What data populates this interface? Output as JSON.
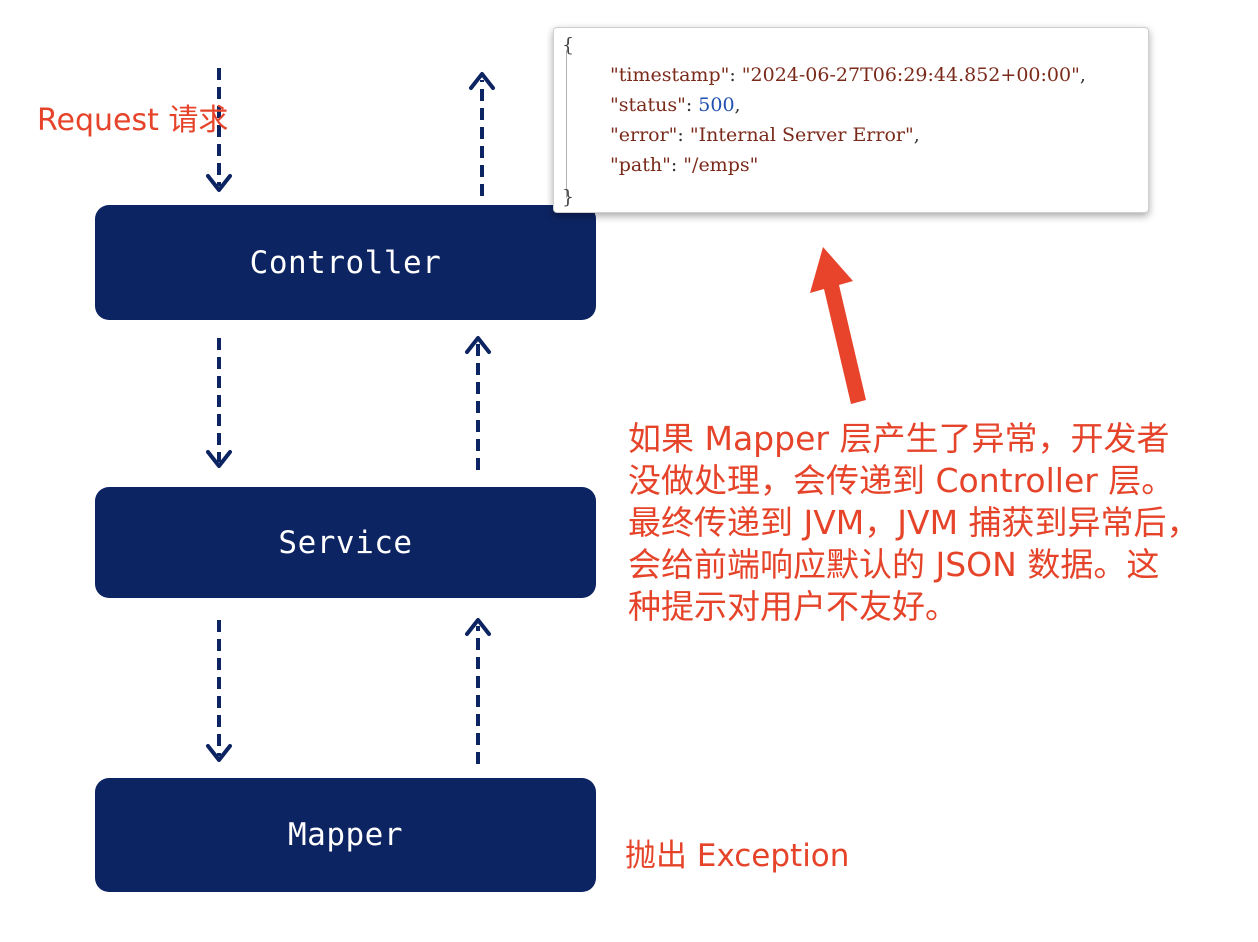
{
  "diagram": {
    "request_label": "Request 请求",
    "layers": {
      "controller": "Controller",
      "service": "Service",
      "mapper": "Mapper"
    },
    "throw_label": "抛出 Exception",
    "annotation_lines": [
      "如果 Mapper 层产生了异常，开发者",
      "没做处理，会传递到 Controller 层。",
      "最终传递到 JVM，JVM 捕获到异常后，",
      "会给前端响应默认的 JSON 数据。这",
      "种提示对用户不友好。"
    ]
  },
  "json_response": {
    "open_brace": "{",
    "close_brace": "}",
    "rows": [
      {
        "key": "\"timestamp\"",
        "sep": ": ",
        "value": "\"2024-06-27T06:29:44.852+00:00\"",
        "tail": ","
      },
      {
        "key": "\"status\"",
        "sep": ": ",
        "value": "500",
        "tail": ","
      },
      {
        "key": "\"error\"",
        "sep": ": ",
        "value": "\"Internal Server Error\"",
        "tail": ","
      },
      {
        "key": "\"path\"",
        "sep": ": ",
        "value": "\"/emps\"",
        "tail": ""
      }
    ]
  },
  "colors": {
    "box": "#0d2462",
    "arrow": "#0d2462",
    "annotation": "#e6442a",
    "pointer_arrow": "#e8432b"
  }
}
